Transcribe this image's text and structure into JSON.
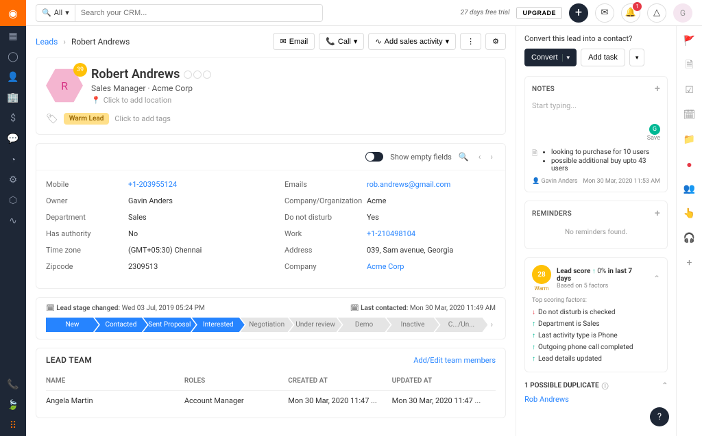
{
  "topbar": {
    "search_scope": "All",
    "search_placeholder": "Search your CRM...",
    "trial_text": "27 days free trial",
    "upgrade_label": "UPGRADE",
    "notification_count": "1",
    "user_initial": "G"
  },
  "breadcrumb": {
    "root": "Leads",
    "current": "Robert Andrews"
  },
  "header_actions": {
    "email": "Email",
    "call": "Call",
    "add_activity": "Add sales activity"
  },
  "profile": {
    "name": "Robert Andrews",
    "initial": "R",
    "score_badge": "39",
    "title": "Sales Manager",
    "company": "Acme Corp",
    "location_placeholder": "Click to add location",
    "warm_tag": "Warm Lead",
    "tags_placeholder": "Click to add tags"
  },
  "details": {
    "toggle_label": "Show empty fields",
    "left": [
      {
        "label": "Mobile",
        "value": "+1-203955124",
        "link": true
      },
      {
        "label": "Owner",
        "value": "Gavin Anders",
        "link": false
      },
      {
        "label": "Department",
        "value": "Sales",
        "link": false
      },
      {
        "label": "Has authority",
        "value": "No",
        "link": false
      },
      {
        "label": "Time zone",
        "value": "(GMT+05:30) Chennai",
        "link": false
      },
      {
        "label": "Zipcode",
        "value": "2309513",
        "link": false
      }
    ],
    "right": [
      {
        "label": "Emails",
        "value": "rob.andrews@gmail.com",
        "link": true
      },
      {
        "label": "Company/Organization",
        "value": "Acme",
        "link": false
      },
      {
        "label": "Do not disturb",
        "value": "Yes",
        "link": false
      },
      {
        "label": "Work",
        "value": "+1-210498104",
        "link": true
      },
      {
        "label": "Address",
        "value": "039, Sam avenue, Georgia",
        "link": false
      },
      {
        "label": "Company",
        "value": "Acme Corp",
        "link": true
      }
    ]
  },
  "stage": {
    "changed_label": "Lead stage changed:",
    "changed_value": "Wed 03 Jul, 2019 05:24 PM",
    "contacted_label": "Last contacted:",
    "contacted_value": "Mon 30 Mar, 2020 11:49 AM",
    "steps": [
      {
        "label": "New",
        "done": true
      },
      {
        "label": "Contacted",
        "done": true
      },
      {
        "label": "Sent Proposal",
        "done": true
      },
      {
        "label": "Interested",
        "done": true
      },
      {
        "label": "Negotiation",
        "done": false
      },
      {
        "label": "Under review",
        "done": false
      },
      {
        "label": "Demo",
        "done": false
      },
      {
        "label": "Inactive",
        "done": false
      },
      {
        "label": "C.../Un...",
        "done": false
      }
    ]
  },
  "team": {
    "title": "LEAD TEAM",
    "edit_link": "Add/Edit team members",
    "headers": {
      "name": "NAME",
      "roles": "ROLES",
      "created": "CREATED AT",
      "updated": "UPDATED AT"
    },
    "rows": [
      {
        "name": "Angela Martin",
        "role": "Account Manager",
        "created": "Mon 30 Mar, 2020 11:47 ...",
        "updated": "Mon 30 Mar, 2020 11:47 ..."
      }
    ]
  },
  "convert": {
    "question": "Convert this lead into a contact?",
    "convert_label": "Convert",
    "add_task_label": "Add task"
  },
  "notes": {
    "title": "NOTES",
    "placeholder": "Start typing...",
    "save_label": "Save",
    "items": [
      {
        "bullets": [
          "looking to purchase for 10 users",
          "possible additional buy upto 43 users"
        ],
        "author": "Gavin Anders",
        "timestamp": "Mon 30 Mar, 2020 11:53 AM"
      }
    ]
  },
  "reminders": {
    "title": "REMINDERS",
    "empty_text": "No reminders found."
  },
  "score_panel": {
    "badge": "28",
    "warm": "Warm",
    "title_prefix": "Lead score",
    "change": "0%",
    "title_suffix": "in last 7 days",
    "sub": "Based on 5 factors",
    "factors_title": "Top scoring factors:",
    "factors": [
      {
        "dir": "down",
        "text": "Do not disturb is checked"
      },
      {
        "dir": "up",
        "text": "Department is Sales"
      },
      {
        "dir": "up",
        "text": "Last activity type is Phone"
      },
      {
        "dir": "up",
        "text": "Outgoing phone call completed"
      },
      {
        "dir": "up",
        "text": "Lead details updated"
      }
    ]
  },
  "duplicate": {
    "title": "1 POSSIBLE DUPLICATE",
    "link": "Rob Andrews"
  }
}
